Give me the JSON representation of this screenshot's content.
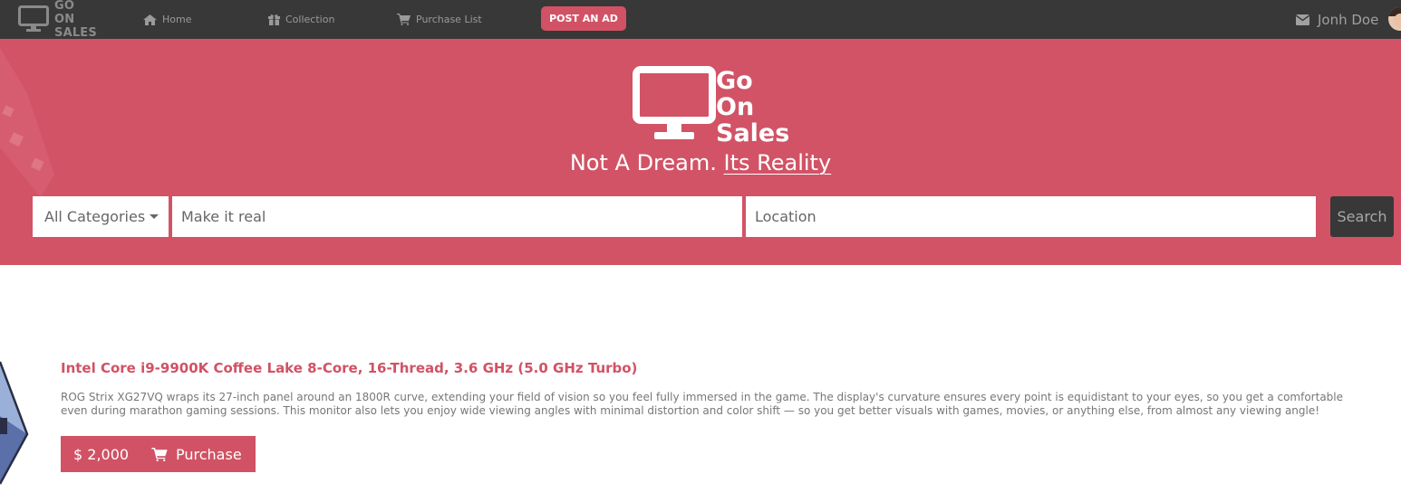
{
  "navbar": {
    "brand": {
      "line1": "GO",
      "line2": "ON",
      "line3": "SALES"
    },
    "items": [
      {
        "label": "Home",
        "icon": "home-icon"
      },
      {
        "label": "Collection",
        "icon": "gift-icon"
      },
      {
        "label": "Purchase List",
        "icon": "cart-icon"
      }
    ],
    "post_ad_label": "POST AN AD",
    "user_name": "Jonh Doe"
  },
  "hero": {
    "logo": {
      "line1": "Go",
      "line2": "On",
      "line3": "Sales"
    },
    "tagline_part1": "Not A Dream.",
    "tagline_part2": "Its Reality",
    "category_label": "All Categories",
    "search_placeholder": "Make it real",
    "location_placeholder": "Location",
    "search_button": "Search"
  },
  "product": {
    "title": "Intel Core i9-9900K Coffee Lake 8-Core, 16-Thread, 3.6 GHz (5.0 GHz Turbo)",
    "desc_line1": "ROG Strix XG27VQ wraps its 27-inch panel around an 1800R curve, extending your field of vision so you feel fully immersed in the game. The display's curvature ensures every point is equidistant to your eyes, so you get a comfortable",
    "desc_line2": "even during marathon gaming sessions. This monitor also lets you enjoy wide viewing angles with minimal distortion and color shift — so you get better visuals with games, movies, or anything else, from almost any viewing angle!",
    "price": "$ 2,000",
    "purchase_label": "Purchase"
  },
  "colors": {
    "accent": "#d25366",
    "navbar": "#383838"
  }
}
